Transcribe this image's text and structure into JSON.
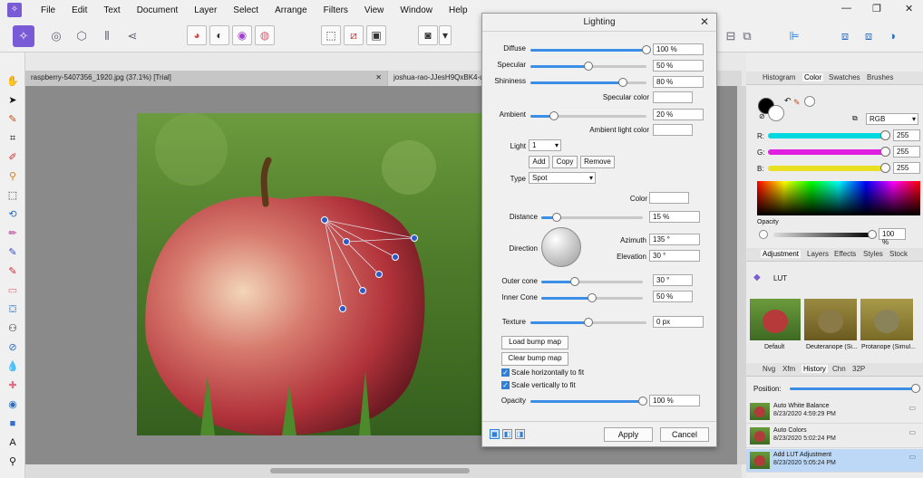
{
  "menu": [
    "File",
    "Edit",
    "Text",
    "Document",
    "Layer",
    "Select",
    "Arrange",
    "Filters",
    "View",
    "Window",
    "Help"
  ],
  "app_logo": "logo-icon",
  "document_tabs": [
    {
      "label": "raspberry-5407356_1920.jpg (37.1%) [Trial]",
      "close": "✕"
    },
    {
      "label": "joshua-rao-JJesH9QxBK4-u"
    }
  ],
  "lighting": {
    "title": "Lighting",
    "diffuse": {
      "label": "Diffuse",
      "value": "100 %",
      "level": 1.0
    },
    "specular": {
      "label": "Specular",
      "value": "50 %",
      "level": 0.5
    },
    "shininess": {
      "label": "Shininess",
      "value": "80 %",
      "level": 0.8
    },
    "specular_color_label": "Specular color",
    "ambient": {
      "label": "Ambient",
      "value": "20 %",
      "level": 0.2
    },
    "ambient_color_label": "Ambient light color",
    "light_label": "Light",
    "light_value": "1",
    "add_label": "Add",
    "copy_label": "Copy",
    "remove_label": "Remove",
    "type_label": "Type",
    "type_value": "Spot",
    "color_label": "Color",
    "distance": {
      "label": "Distance",
      "value": "15 %",
      "level": 0.15
    },
    "direction_label": "Direction",
    "azimuth": {
      "label": "Azimuth",
      "value": "135 °"
    },
    "elevation": {
      "label": "Elevation",
      "value": "30 °"
    },
    "outer_cone": {
      "label": "Outer cone",
      "value": "30 °",
      "level": 0.33
    },
    "inner_cone": {
      "label": "Inner Cone",
      "value": "50 %",
      "level": 0.5
    },
    "texture": {
      "label": "Texture",
      "value": "0 px",
      "level": 0.5
    },
    "load_bump_label": "Load bump map",
    "clear_bump_label": "Clear bump map",
    "scale_h_label": "Scale horizontally to fit",
    "scale_v_label": "Scale vertically to fit",
    "opacity": {
      "label": "Opacity",
      "value": "100 %",
      "level": 1.0
    },
    "apply_label": "Apply",
    "cancel_label": "Cancel"
  },
  "color_panel": {
    "tabs": [
      "Histogram",
      "Color",
      "Swatches",
      "Brushes"
    ],
    "active_tab": "Color",
    "mode": "RGB",
    "channels": [
      {
        "label": "R:",
        "value": "255",
        "color": "#00d8e0"
      },
      {
        "label": "G:",
        "value": "255",
        "color": "#e020e0"
      },
      {
        "label": "B:",
        "value": "255",
        "color": "#e8e020"
      }
    ],
    "opacity_label": "Opacity",
    "opacity_value": "100 %"
  },
  "adjustment_panel": {
    "tabs": [
      "Adjustment",
      "Layers",
      "Effects",
      "Styles",
      "Stock"
    ],
    "active_tab": "Adjustment",
    "group": "LUT",
    "presets": [
      "Default",
      "Deuteranope (Si...",
      "Protanope (Simul..."
    ]
  },
  "history_panel": {
    "tabs": [
      "Nvg",
      "Xfm",
      "History",
      "Chn",
      "32P"
    ],
    "active_tab": "History",
    "position_label": "Position:",
    "items": [
      {
        "name": "Auto White Balance",
        "time": "8/23/2020 4:59:29 PM"
      },
      {
        "name": "Auto Colors",
        "time": "8/23/2020 5:02:24 PM"
      },
      {
        "name": "Add LUT Adjustment",
        "time": "8/23/2020 5:05:24 PM"
      }
    ]
  }
}
